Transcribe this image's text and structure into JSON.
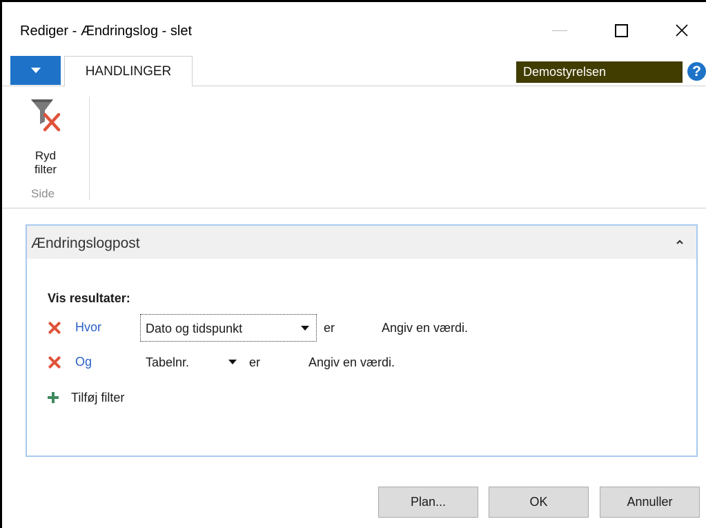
{
  "window": {
    "title": "Rediger - Ændringslog - slet"
  },
  "ribbon": {
    "tab_label": "HANDLINGER",
    "company": "Demostyrelsen",
    "help_glyph": "?",
    "clear_filter_label_1": "Ryd",
    "clear_filter_label_2": "filter",
    "group_label": "Side",
    "clear_filter_icon": "funnel-clear-icon"
  },
  "panel": {
    "title": "Ændringslogpost",
    "show_results_label": "Vis resultater:",
    "filters": [
      {
        "conjunction": "Hvor",
        "field": "Dato og tidspunkt",
        "operator": "er",
        "value_placeholder": "Angiv en værdi."
      },
      {
        "conjunction": "Og",
        "field": "Tabelnr.",
        "operator": "er",
        "value_placeholder": "Angiv en værdi."
      }
    ],
    "add_filter_label": "Tilføj filter"
  },
  "buttons": {
    "plan": "Plan...",
    "ok": "OK",
    "cancel": "Annuller"
  },
  "colors": {
    "accent_blue": "#1e73c8",
    "company_bg": "#413c00",
    "remove_red": "#e0533a",
    "add_green": "#3e8a5f",
    "link_blue": "#2a61c6",
    "panel_border": "#a8c9ee"
  }
}
